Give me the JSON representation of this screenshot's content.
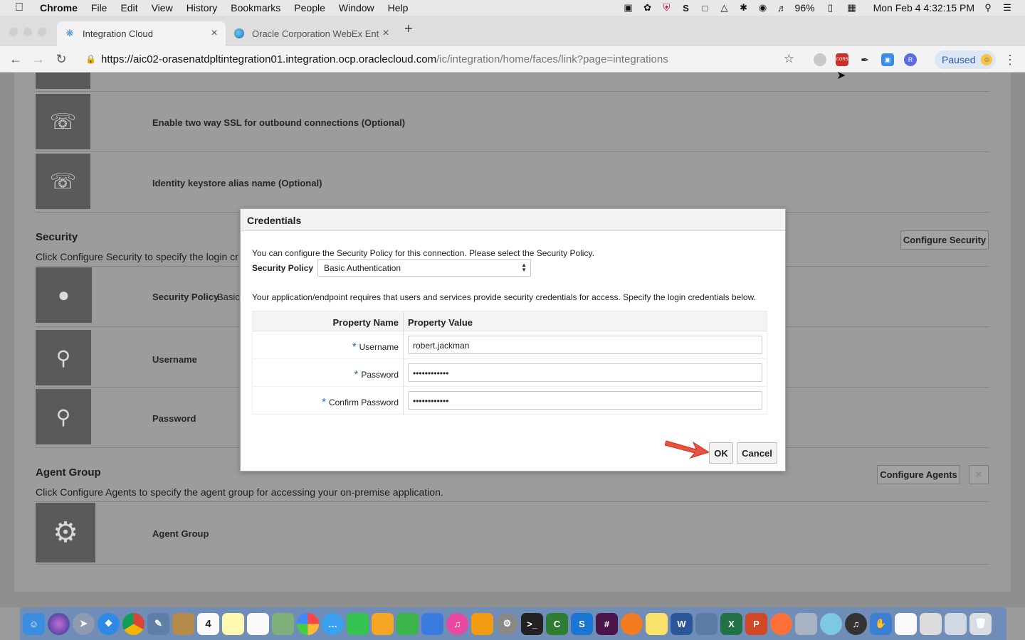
{
  "menubar": {
    "app_name": "Chrome",
    "menus": [
      "File",
      "Edit",
      "View",
      "History",
      "Bookmarks",
      "People",
      "Window",
      "Help"
    ],
    "battery": "96%",
    "datetime": "Mon Feb 4  4:32:15 PM",
    "status_icons": [
      "cast-icon",
      "gear-status-icon",
      "shield-icon",
      "s-app-icon",
      "display-icon",
      "airplay-icon",
      "bluetooth-icon",
      "wifi-icon",
      "volume-icon",
      "battery-icon",
      "calendar-icon"
    ]
  },
  "tabs": [
    {
      "title": "Integration Cloud",
      "icon": "integration-cloud-icon",
      "active": true
    },
    {
      "title": "Oracle Corporation WebEx Ent",
      "icon": "webex-icon",
      "active": false
    }
  ],
  "toolbar": {
    "url_host": "https://aic02-orasenatdpltintegration01.integration.ocp.oraclecloud.com",
    "url_path": "/ic/integration/home/faces/link?page=integrations",
    "profile_label": "Paused",
    "extensions": [
      "grey-circle-extension-icon",
      "cors-extension-icon",
      "feather-extension-icon",
      "screenshot-extension-icon",
      "r-extension-icon"
    ],
    "cors_label": "CORS"
  },
  "page": {
    "rows_top": [
      {
        "label": "Enable two way SSL for outbound connections (Optional)",
        "icon": "connection-icon"
      },
      {
        "label": "Identity keystore alias name (Optional)",
        "icon": "connection-icon"
      }
    ],
    "security": {
      "heading": "Security",
      "description": "Click Configure Security to specify the login cr",
      "button": "Configure Security",
      "rows": [
        {
          "label": "Security Policy",
          "value": "Basic",
          "icon": "lock-icon"
        },
        {
          "label": "Username",
          "icon": "key-icon"
        },
        {
          "label": "Password",
          "icon": "key-icon"
        }
      ]
    },
    "agent_group": {
      "heading": "Agent Group",
      "description": "Click Configure Agents to specify the agent group for accessing your on-premise application.",
      "button": "Configure Agents",
      "row_label": "Agent Group",
      "row_icon": "gear-icon"
    }
  },
  "dialog": {
    "title": "Credentials",
    "intro": "You can configure the Security Policy for this connection. Please select the Security Policy.",
    "policy_label": "Security Policy",
    "policy_value": "Basic Authentication",
    "instructions": "Your application/endpoint requires that users and services provide security credentials for access. Specify the login credentials below.",
    "col_name": "Property Name",
    "col_value": "Property Value",
    "properties": [
      {
        "name": "Username",
        "value": "robert.jackman",
        "required": "*"
      },
      {
        "name": "Password",
        "value": "••••••••••••",
        "required": "*"
      },
      {
        "name": "Confirm Password",
        "value": "••••••••••••",
        "required": "*"
      }
    ],
    "ok_label": "OK",
    "cancel_label": "Cancel"
  },
  "dock": {
    "apps": [
      "finder-icon",
      "siri-icon",
      "launchpad-icon",
      "safari-icon",
      "chrome-icon",
      "preview-icon",
      "notes-brown-icon",
      "calendar-icon",
      "stickies-icon",
      "reminders-icon",
      "maps-icon",
      "photos-icon",
      "messages-icon",
      "facetime-icon",
      "pages-icon",
      "numbers-icon",
      "keynote-icon",
      "itunes-icon",
      "ibooks-icon",
      "system-preferences-icon",
      "terminal-icon",
      "camtasia-icon",
      "s-app-icon",
      "slack-icon",
      "paw-icon",
      "notes-yellow-icon",
      "word-icon",
      "virtualbox-icon",
      "excel-icon",
      "powerpoint-icon",
      "firefox-icon",
      "disk-utility-icon",
      "bubble-icon",
      "headphones-icon",
      "hand-icon",
      "oracle-handshake-icon",
      "scanner-icon",
      "network-icon",
      "trash-icon"
    ],
    "calendar_day": "4"
  }
}
